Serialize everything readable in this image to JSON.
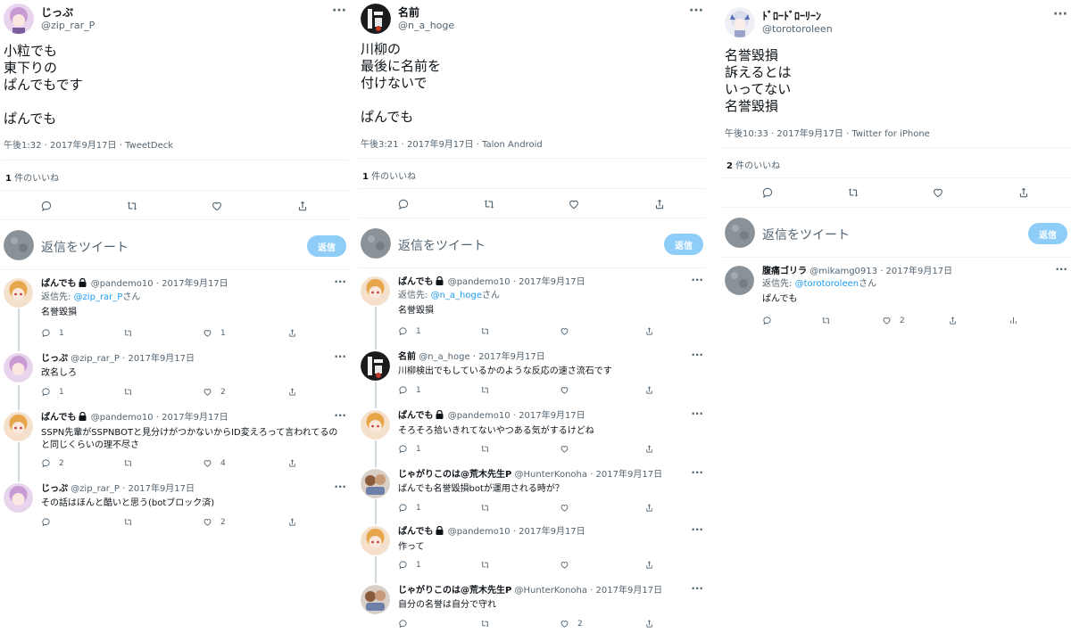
{
  "colors": {
    "accent": "#1d9bf0",
    "reply_button": "#8ecdf7",
    "text": "#0f1419",
    "muted": "#536471"
  },
  "columns": [
    {
      "main": {
        "name": "じっぷ",
        "handle": "@zip_rar_P",
        "text": "小粒でも\n東下りの\nぱんでもです\n\nぱんでも",
        "meta": "午後1:32 · 2017年9月17日 · TweetDeck",
        "likes_count": "1",
        "likes_label": " 件のいいね"
      },
      "reply_placeholder": "返信をツイート",
      "reply_button": "返信",
      "replies": [
        {
          "name": "ぱんでも",
          "locked": true,
          "handle": "@pandemo10",
          "date": "· 2017年9月17日",
          "replyto_prefix": "返信先: ",
          "replyto_mention": "@zip_rar_P",
          "replyto_suffix": "さん",
          "text": "名誉毀損",
          "reply_count": "1",
          "retweet_count": "",
          "like_count": "1"
        },
        {
          "name": "じっぷ",
          "locked": false,
          "handle": "@zip_rar_P",
          "date": "· 2017年9月17日",
          "text": "改名しろ",
          "reply_count": "1",
          "retweet_count": "",
          "like_count": "2"
        },
        {
          "name": "ぱんでも",
          "locked": true,
          "handle": "@pandemo10",
          "date": "· 2017年9月17日",
          "text": "SSPN先輩がSSPNBOTと見分けがつかないからID変えろって言われてるのと同じくらいの理不尽さ",
          "reply_count": "2",
          "retweet_count": "",
          "like_count": "4"
        },
        {
          "name": "じっぷ",
          "locked": false,
          "handle": "@zip_rar_P",
          "date": "· 2017年9月17日",
          "text": "その話はほんと酷いと思う(botブロック済)",
          "reply_count": "",
          "retweet_count": "",
          "like_count": "2"
        }
      ]
    },
    {
      "main": {
        "name": "名前",
        "handle": "@n_a_hoge",
        "text": "川柳の\n最後に名前を\n付けないで\n\nぱんでも",
        "meta": "午後3:21 · 2017年9月17日 · Talon Android",
        "likes_count": "1",
        "likes_label": " 件のいいね"
      },
      "reply_placeholder": "返信をツイート",
      "reply_button": "返信",
      "replies": [
        {
          "name": "ぱんでも",
          "locked": true,
          "handle": "@pandemo10",
          "date": "· 2017年9月17日",
          "replyto_prefix": "返信先: ",
          "replyto_mention": "@n_a_hoge",
          "replyto_suffix": "さん",
          "text": "名誉毀損",
          "reply_count": "1",
          "retweet_count": "",
          "like_count": ""
        },
        {
          "name": "名前",
          "locked": false,
          "handle": "@n_a_hoge",
          "date": "· 2017年9月17日",
          "text": "川柳検出でもしているかのような反応の速さ流石です",
          "reply_count": "1",
          "retweet_count": "",
          "like_count": ""
        },
        {
          "name": "ぱんでも",
          "locked": true,
          "handle": "@pandemo10",
          "date": "· 2017年9月17日",
          "text": "そろそろ拾いきれてないやつある気がするけどね",
          "reply_count": "1",
          "retweet_count": "",
          "like_count": ""
        },
        {
          "name": "じゃがりこのは@荒木先生P",
          "locked": false,
          "handle": "@HunterKonoha",
          "date": "· 2017年9月17日",
          "text": "ぱんでも名誉毀損botが運用される時が？",
          "reply_count": "1",
          "retweet_count": "",
          "like_count": ""
        },
        {
          "name": "ぱんでも",
          "locked": true,
          "handle": "@pandemo10",
          "date": "· 2017年9月17日",
          "text": "作って",
          "reply_count": "1",
          "retweet_count": "",
          "like_count": ""
        },
        {
          "name": "じゃがりこのは@荒木先生P",
          "locked": false,
          "handle": "@HunterKonoha",
          "date": "· 2017年9月17日",
          "text": "自分の名誉は自分で守れ",
          "reply_count": "",
          "retweet_count": "",
          "like_count": "2"
        }
      ]
    },
    {
      "main": {
        "name": "ﾄﾞﾛｰﾄﾞﾛｰﾘｰﾝ",
        "handle": "@torotoroleen",
        "text": "名誉毀損\n訴えるとは\nいってない\n名誉毀損",
        "meta": "午後10:33 · 2017年9月17日 · Twitter for iPhone",
        "likes_count": "2",
        "likes_label": " 件のいいね"
      },
      "reply_placeholder": "返信をツイート",
      "reply_button": "返信",
      "replies": [
        {
          "name": "腹痛ゴリラ",
          "locked": false,
          "handle": "@mikamg0913",
          "date": "· 2017年9月17日",
          "replyto_prefix": "返信先: ",
          "replyto_mention": "@torotoroleen",
          "replyto_suffix": "さん",
          "text": "ぱんでも",
          "reply_count": "",
          "retweet_count": "",
          "like_count": "2"
        }
      ]
    }
  ]
}
